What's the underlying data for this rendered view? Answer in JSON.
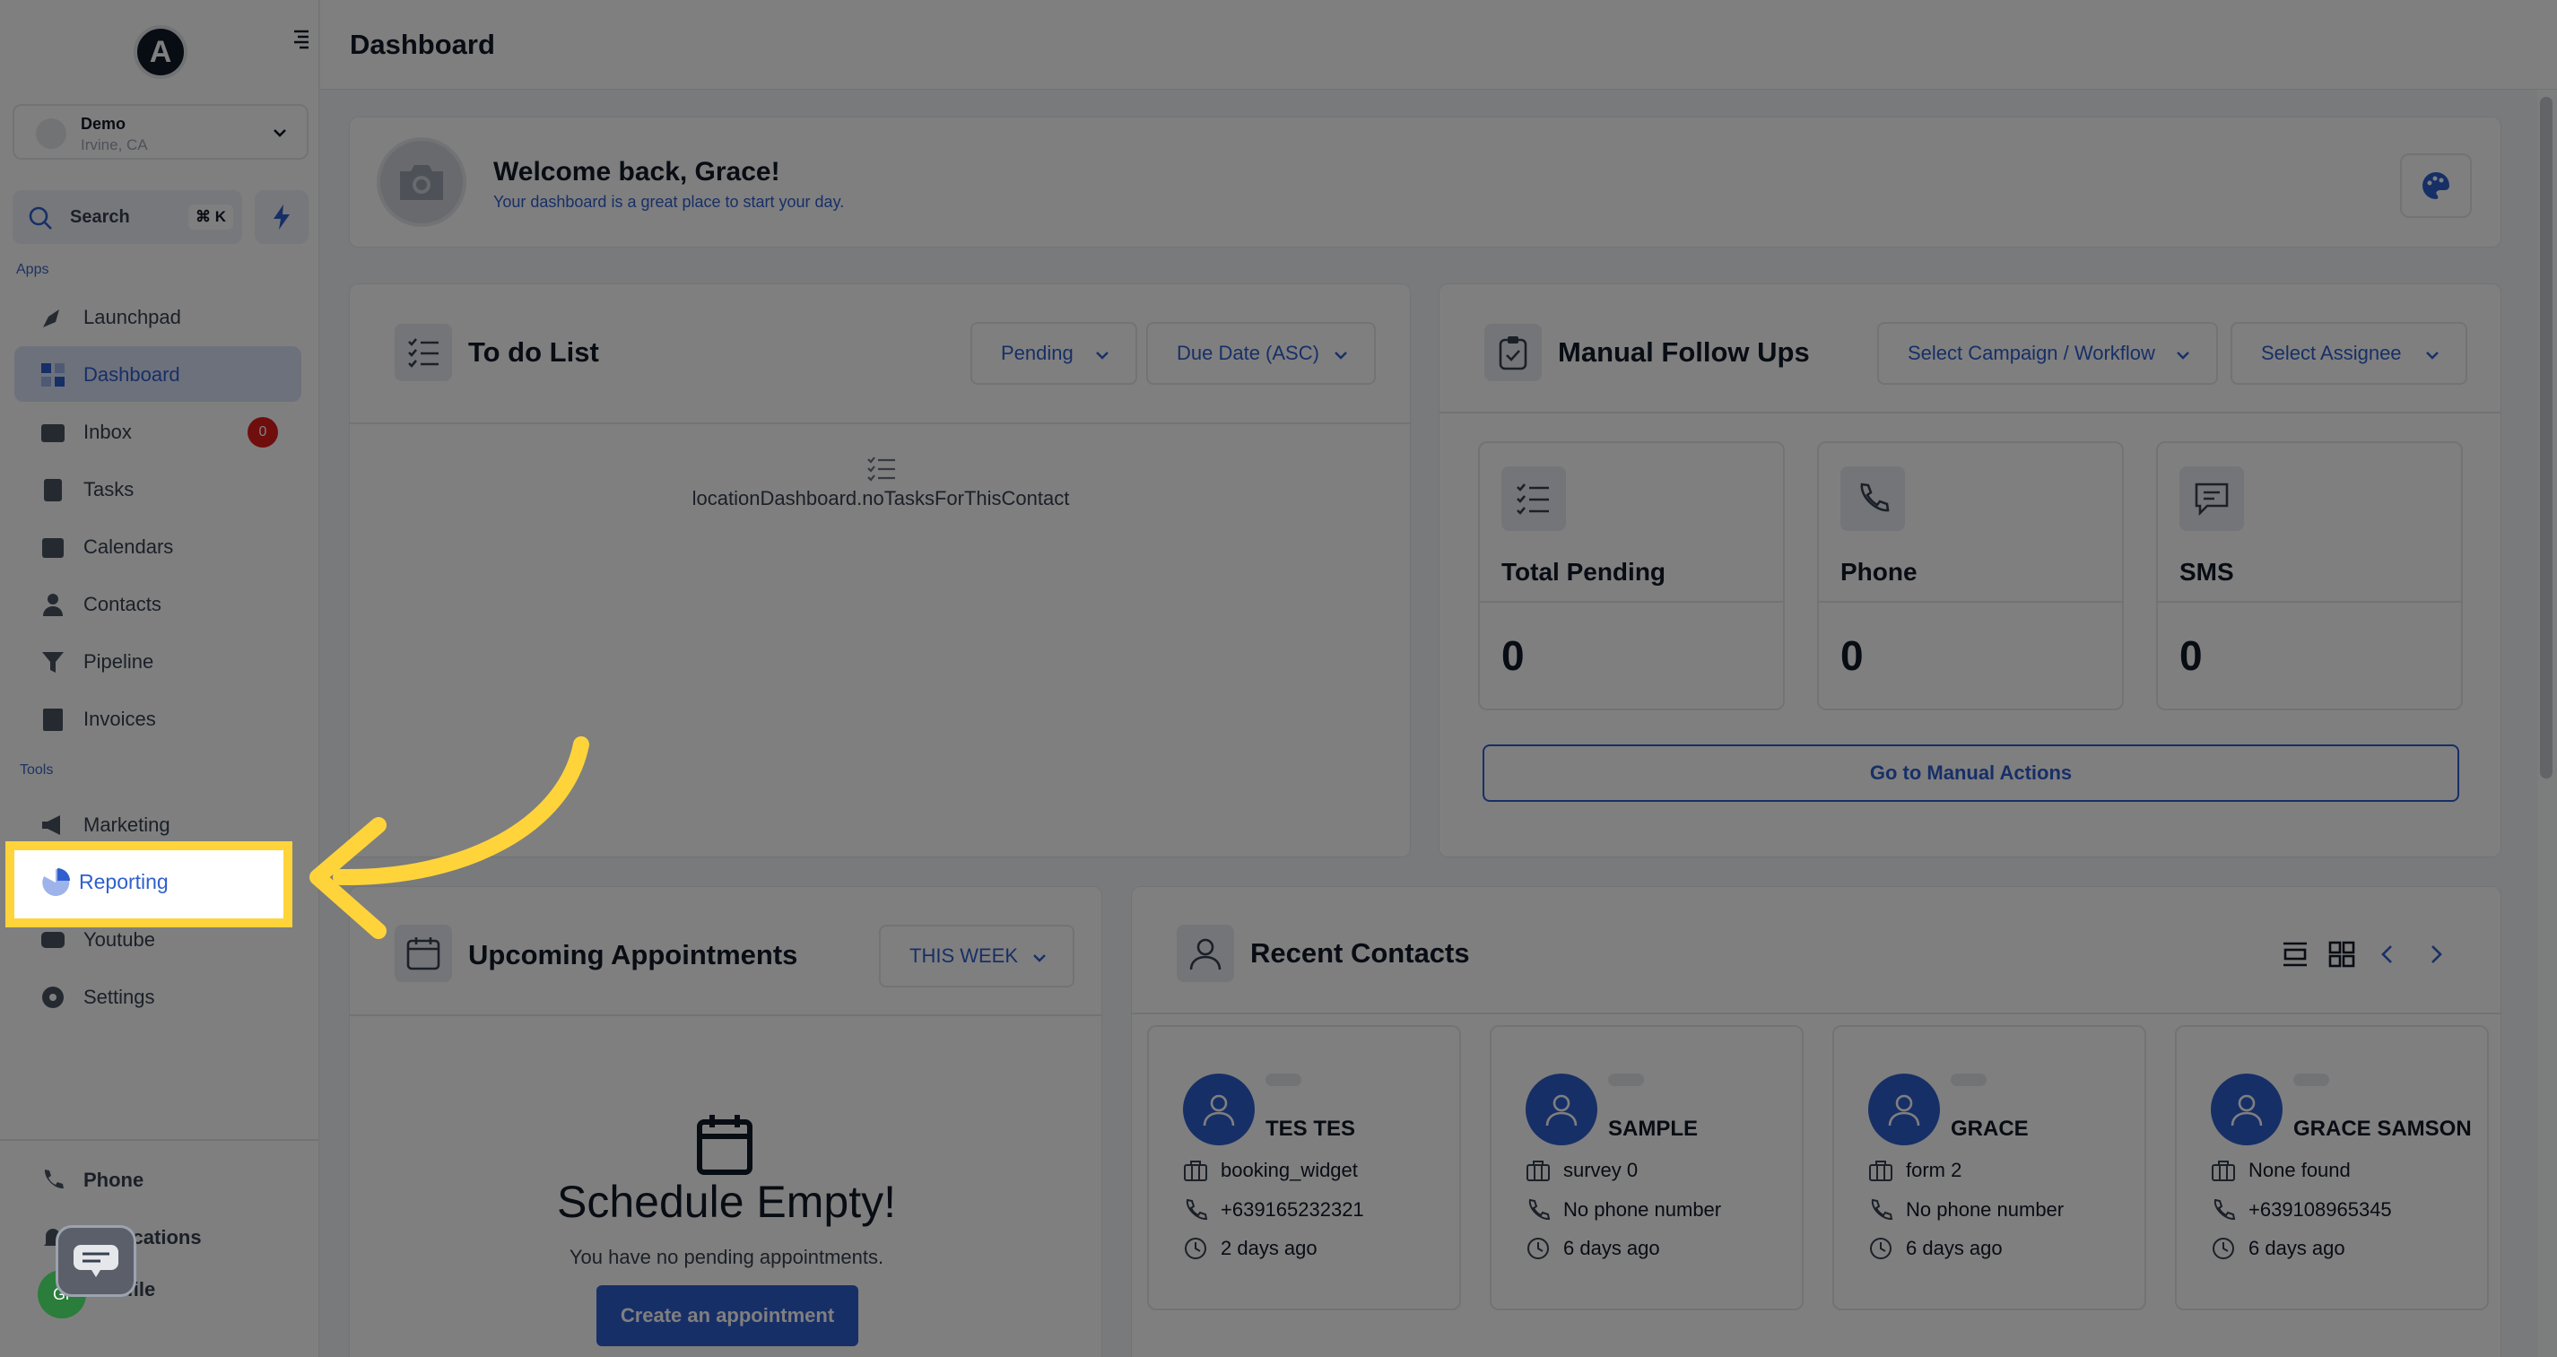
{
  "sidebar": {
    "logo_letter": "A",
    "account": {
      "name": "Demo",
      "location": "Irvine, CA"
    },
    "search": {
      "label": "Search",
      "shortcut": "⌘ K"
    },
    "apps_label": "Apps",
    "tools_label": "Tools",
    "apps": [
      {
        "label": "Launchpad",
        "icon": "rocket-icon"
      },
      {
        "label": "Dashboard",
        "icon": "grid-icon",
        "active": true
      },
      {
        "label": "Inbox",
        "icon": "inbox-icon",
        "badge": "0"
      },
      {
        "label": "Tasks",
        "icon": "clipboard-icon"
      },
      {
        "label": "Calendars",
        "icon": "calendar-icon"
      },
      {
        "label": "Contacts",
        "icon": "person-icon"
      },
      {
        "label": "Pipeline",
        "icon": "funnel-icon"
      },
      {
        "label": "Invoices",
        "icon": "invoice-icon"
      }
    ],
    "tools": [
      {
        "label": "Marketing",
        "icon": "megaphone-icon"
      },
      {
        "label": "Reporting",
        "icon": "pie-chart-icon"
      },
      {
        "label": "Youtube",
        "icon": "youtube-icon"
      },
      {
        "label": "Settings",
        "icon": "gear-icon"
      }
    ],
    "bottom": [
      {
        "label": "Phone",
        "icon": "phone-icon"
      },
      {
        "label": "ifications",
        "icon": "bell-icon"
      },
      {
        "label": "ofile",
        "icon": "profile-icon"
      }
    ],
    "avatar_initials": "Gr"
  },
  "header": {
    "title": "Dashboard"
  },
  "welcome": {
    "title": "Welcome back, Grace!",
    "subtitle": "Your dashboard is a great place to start your day."
  },
  "todo": {
    "title": "To do List",
    "filter_status": "Pending",
    "filter_sort": "Due Date (ASC)",
    "empty_text": "locationDashboard.noTasksForThisContact"
  },
  "followups": {
    "title": "Manual Follow Ups",
    "campaign_select": "Select Campaign / Workflow",
    "assignee_select": "Select Assignee",
    "stats": [
      {
        "label": "Total Pending",
        "value": "0"
      },
      {
        "label": "Phone",
        "value": "0"
      },
      {
        "label": "SMS",
        "value": "0"
      }
    ],
    "button": "Go to Manual Actions"
  },
  "appointments": {
    "title": "Upcoming Appointments",
    "range": "THIS WEEK",
    "empty_title": "Schedule Empty!",
    "empty_sub": "You have no pending appointments.",
    "create_button": "Create an appointment"
  },
  "recent": {
    "title": "Recent Contacts",
    "contacts": [
      {
        "name": "TES TES",
        "source": "booking_widget",
        "phone": "+639165232321",
        "time": "2 days ago"
      },
      {
        "name": "SAMPLE",
        "source": "survey 0",
        "phone": "No phone number",
        "time": "6 days ago"
      },
      {
        "name": "GRACE",
        "source": "form 2",
        "phone": "No phone number",
        "time": "6 days ago"
      },
      {
        "name": "GRACE SAMSON",
        "source": "None found",
        "phone": "+639108965345",
        "time": "6 days ago"
      }
    ]
  },
  "colors": {
    "accent": "#2f5fce",
    "highlight": "#ffd43b",
    "badge": "#e11d1d"
  }
}
